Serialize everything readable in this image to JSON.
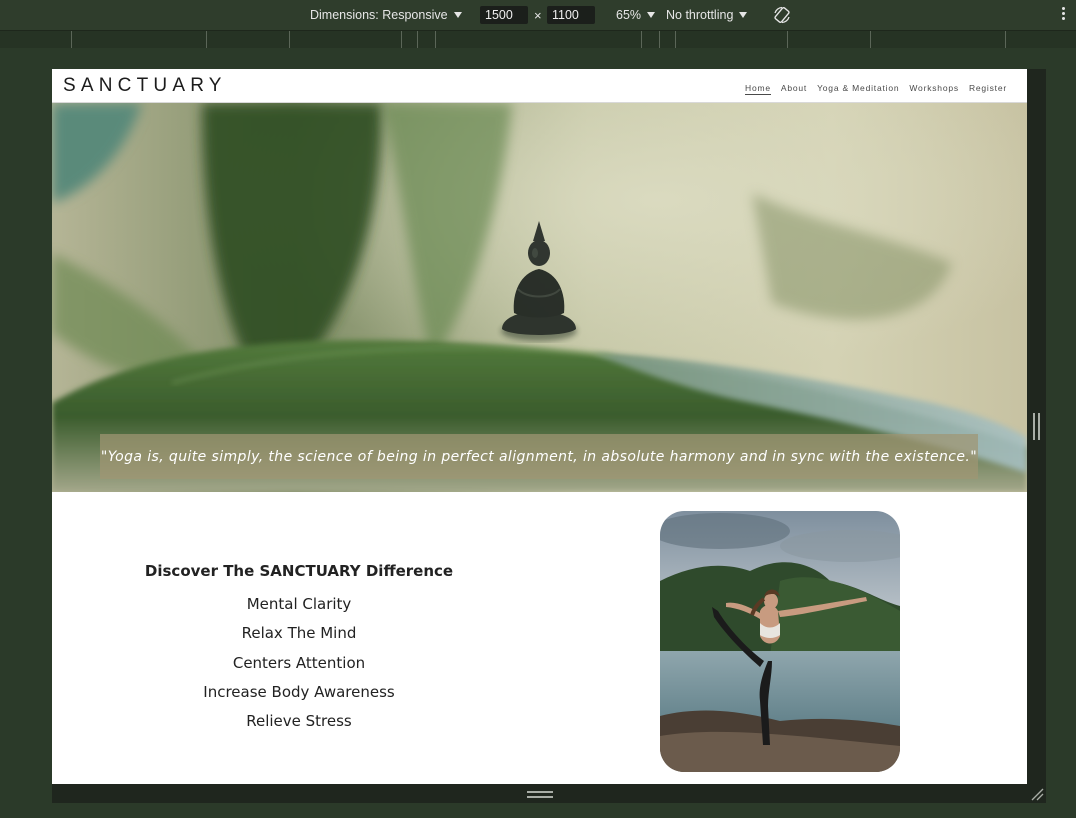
{
  "devtools": {
    "dimensions_label": "Dimensions: Responsive",
    "width_value": "1500",
    "height_value": "1100",
    "times_sign": "×",
    "zoom_label": "65%",
    "throttling_label": "No throttling",
    "rotate_icon": "rotate-icon",
    "more_icon": "kebab-menu-icon"
  },
  "site": {
    "logo": "SANCTUARY",
    "nav": [
      {
        "label": "Home",
        "active": true
      },
      {
        "label": "About"
      },
      {
        "label": "Yoga & Meditation"
      },
      {
        "label": "Workshops"
      },
      {
        "label": "Register"
      }
    ],
    "hero_quote": "\"Yoga is, quite simply, the science of being in perfect alignment, in absolute harmony and in sync with the existence.\"",
    "features": {
      "heading": "Discover The SANCTUARY Difference",
      "items": [
        "Mental Clarity",
        "Relax The Mind",
        "Centers Attention",
        "Increase Body Awareness",
        "Relieve Stress"
      ]
    }
  },
  "colors": {
    "page_background": "#2b3a29",
    "toolbar": "#2f3d2c",
    "quote_overlay": "#a0966f"
  }
}
